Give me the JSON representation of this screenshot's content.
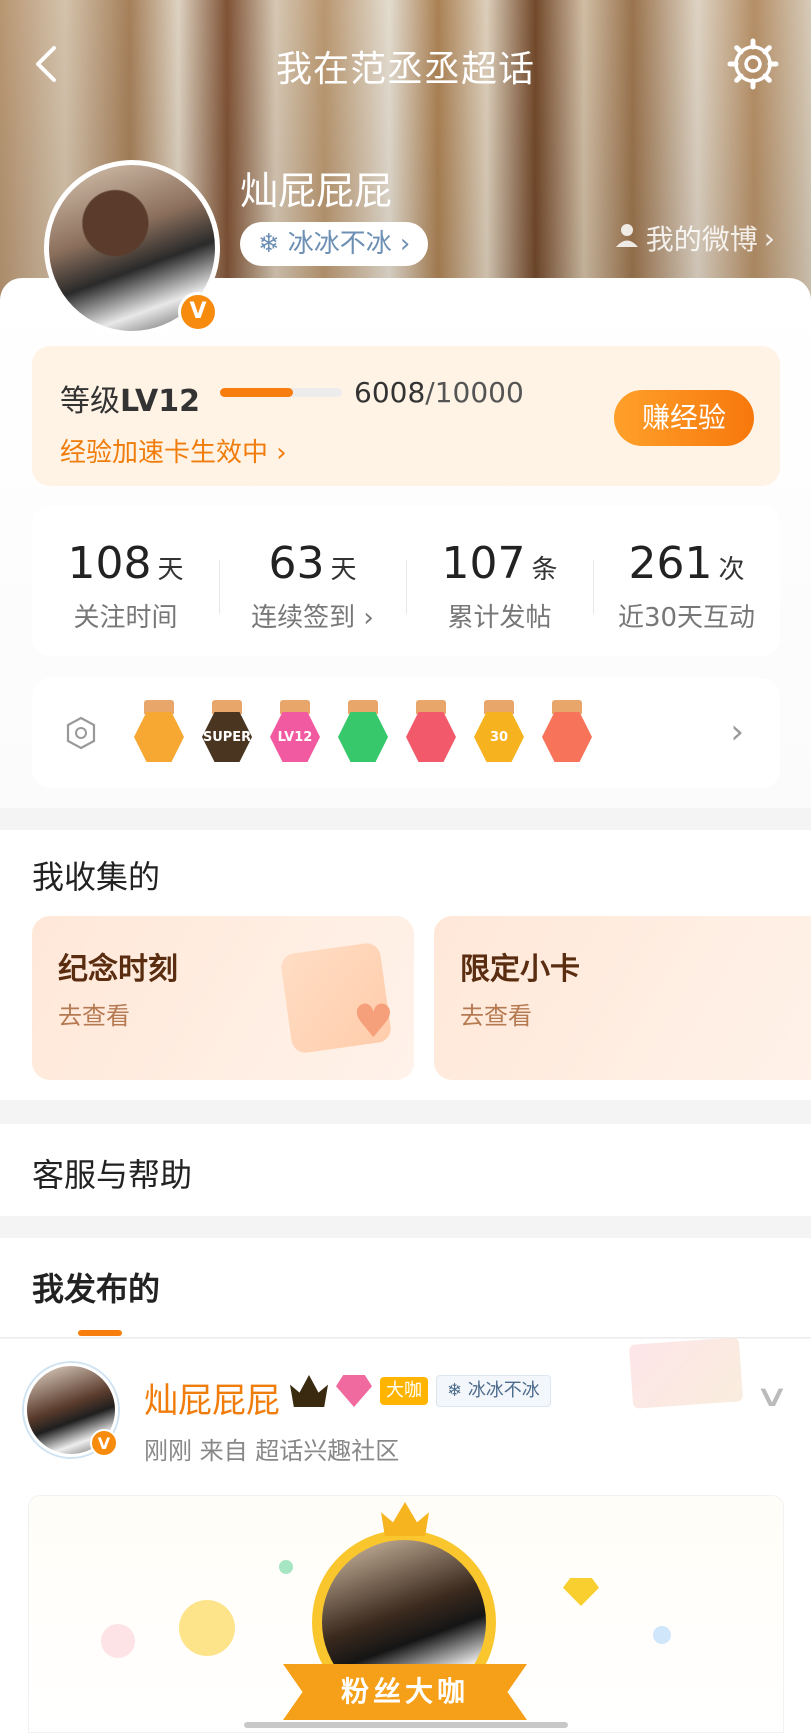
{
  "header": {
    "title": "我在范丞丞超话",
    "back_icon": "back-arrow-icon",
    "settings_icon": "gear-icon"
  },
  "profile": {
    "name": "灿屁屁屁",
    "tag": "冰冰不冰",
    "tag_icon": "snowflake-icon",
    "my_weibo": "我的微博"
  },
  "level": {
    "label_prefix": "等级",
    "level": "LV12",
    "exp_current": "6008",
    "exp_max": "/10000",
    "progress": 0.6008,
    "boost_text": "经验加速卡生效中",
    "earn_button": "赚经验"
  },
  "stats": [
    {
      "value": "108",
      "unit": "天",
      "label": "关注时间"
    },
    {
      "value": "63",
      "unit": "天",
      "label": "连续签到"
    },
    {
      "value": "107",
      "unit": "条",
      "label": "累计发帖"
    },
    {
      "value": "261",
      "unit": "次",
      "label": "近30天互动"
    }
  ],
  "badges": [
    {
      "name": "crown-badge",
      "color": "#f7a833",
      "text": ""
    },
    {
      "name": "super-badge",
      "color": "#4a3520",
      "text": "SUPER"
    },
    {
      "name": "lv12-badge",
      "color": "#f15aa0",
      "text": "LV12"
    },
    {
      "name": "hand-badge",
      "color": "#36c86a",
      "text": ""
    },
    {
      "name": "trophy-badge",
      "color": "#f25a6b",
      "text": ""
    },
    {
      "name": "30days-badge",
      "color": "#f6b31f",
      "text": "30"
    },
    {
      "name": "like-badge",
      "color": "#f7735a",
      "text": ""
    }
  ],
  "collect": {
    "title": "我收集的",
    "cards": [
      {
        "title": "纪念时刻",
        "sub": "去查看"
      },
      {
        "title": "限定小卡",
        "sub": "去查看"
      }
    ]
  },
  "help": {
    "title": "客服与帮助"
  },
  "posts": {
    "title": "我发布的",
    "item": {
      "name": "灿屁屁屁",
      "daka": "大咖",
      "tag": "冰冰不冰",
      "meta": "刚刚   来自 超话兴趣社区",
      "ribbon": "粉丝大咖"
    }
  }
}
